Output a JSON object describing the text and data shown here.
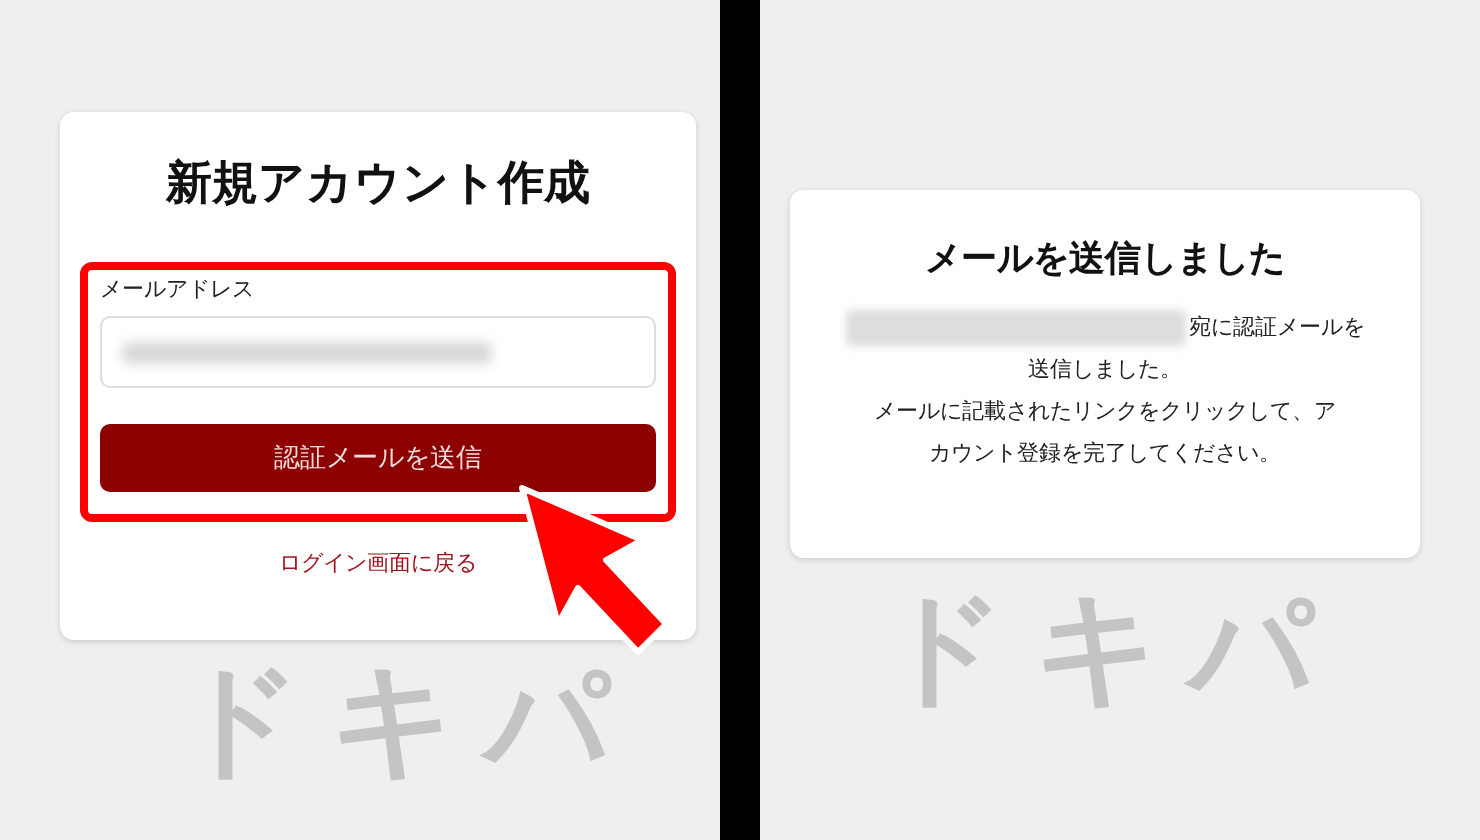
{
  "signup_panel": {
    "title": "新規アカウント作成",
    "email_label": "メールアドレス",
    "send_button": "認証メールを送信",
    "back_link": "ログイン画面に戻る",
    "background_logo": "ドキパ"
  },
  "sent_panel": {
    "title": "メールを送信しました",
    "message_lines": [
      "宛に認証メールを",
      "送信しました。",
      "メールに記載されたリンクをクリックして、ア",
      "カウント登録を完了してください。"
    ],
    "background_logo": "ドキパ"
  }
}
